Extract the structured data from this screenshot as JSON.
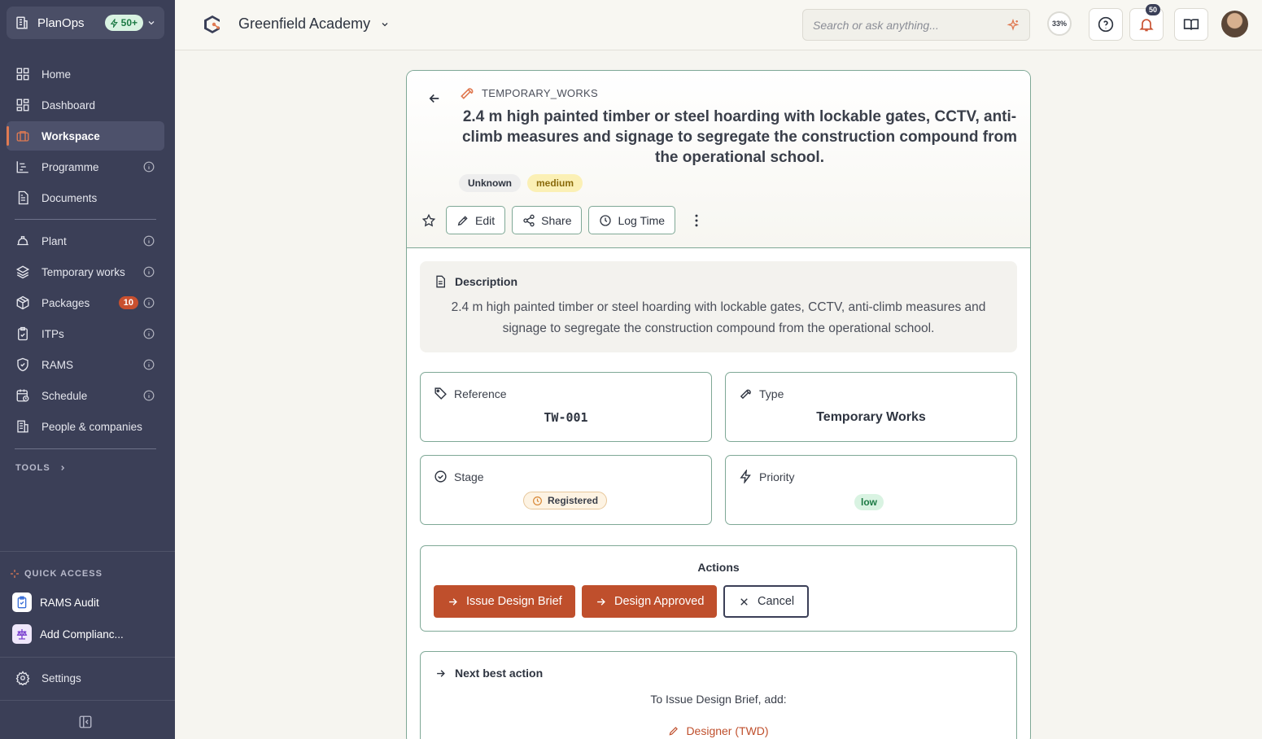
{
  "sidebar": {
    "org_name": "PlanOps",
    "org_badge": "50+",
    "items": [
      {
        "label": "Home"
      },
      {
        "label": "Dashboard"
      },
      {
        "label": "Workspace"
      },
      {
        "label": "Programme"
      },
      {
        "label": "Documents"
      },
      {
        "label": "Plant"
      },
      {
        "label": "Temporary works"
      },
      {
        "label": "Packages",
        "count": "10"
      },
      {
        "label": "ITPs"
      },
      {
        "label": "RAMS"
      },
      {
        "label": "Schedule"
      },
      {
        "label": "People & companies"
      }
    ],
    "tools_label": "TOOLS",
    "quick_access_label": "QUICK ACCESS",
    "quick_access": [
      {
        "label": "RAMS Audit"
      },
      {
        "label": "Add Complianc..."
      }
    ],
    "settings_label": "Settings"
  },
  "topbar": {
    "project": "Greenfield Academy",
    "search_placeholder": "Search or ask anything...",
    "progress": "33%",
    "notifications": "50"
  },
  "item": {
    "kind": "TEMPORARY_WORKS",
    "title": "2.4 m high painted timber or steel hoarding with lockable gates, CCTV, anti-climb measures and signage to segregate the construction compound from the operational school.",
    "tags": [
      "Unknown",
      "medium"
    ],
    "toolbar": {
      "edit": "Edit",
      "share": "Share",
      "log_time": "Log Time"
    },
    "description_label": "Description",
    "description": "2.4 m high painted timber or steel hoarding with lockable gates, CCTV, anti-climb measures and signage to segregate the construction compound from the operational school.",
    "reference_label": "Reference",
    "reference": "TW-001",
    "type_label": "Type",
    "type": "Temporary Works",
    "stage_label": "Stage",
    "stage": "Registered",
    "priority_label": "Priority",
    "priority": "low",
    "actions_label": "Actions",
    "actions": {
      "issue": "Issue Design Brief",
      "approved": "Design Approved",
      "cancel": "Cancel"
    },
    "nba_label": "Next best action",
    "nba_text": "To Issue Design Brief, add:",
    "nba_link": "Designer (TWD)"
  },
  "colors": {
    "accent": "#bf4f2c",
    "sidebar": "#3b3f57",
    "border": "#7fa896"
  }
}
